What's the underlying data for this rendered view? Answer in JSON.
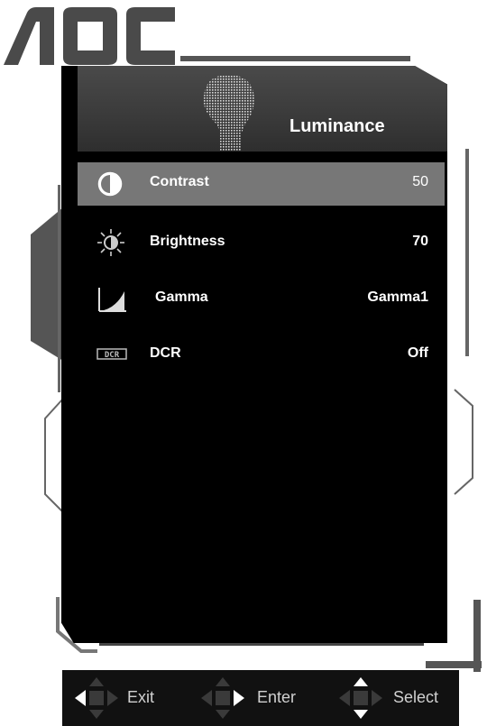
{
  "brand": {
    "logo_text": "AOC"
  },
  "osd": {
    "title": "Luminance",
    "items": [
      {
        "label": "Contrast",
        "value": "50",
        "icon": "contrast-icon",
        "selected": true
      },
      {
        "label": "Brightness",
        "value": "70",
        "icon": "brightness-icon",
        "selected": false
      },
      {
        "label": "Gamma",
        "value": "Gamma1",
        "icon": "gamma-icon",
        "selected": false
      },
      {
        "label": "DCR",
        "value": "Off",
        "icon": "dcr-icon",
        "selected": false
      }
    ]
  },
  "navbar": {
    "exit_label": "Exit",
    "enter_label": "Enter",
    "select_label": "Select"
  },
  "colors": {
    "panel": "#000000",
    "header": "#3a3a3a",
    "selected_row": "#777777",
    "frame": "#555555",
    "text": "#ffffff"
  }
}
